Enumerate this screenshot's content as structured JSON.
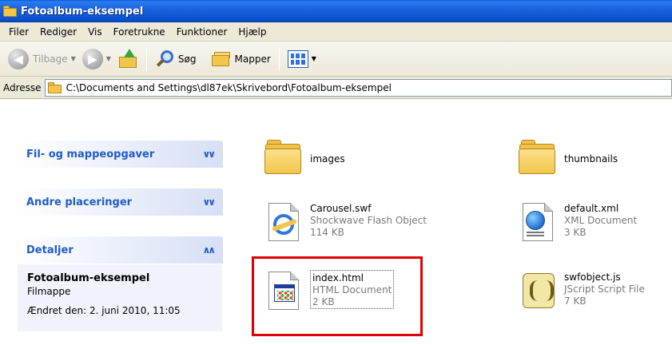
{
  "window": {
    "title": "Fotoalbum-eksempel"
  },
  "menu": [
    "Filer",
    "Rediger",
    "Vis",
    "Foretrukne",
    "Funktioner",
    "Hjælp"
  ],
  "toolbar": {
    "back_label": "Tilbage",
    "search_label": "Søg",
    "folders_label": "Mapper"
  },
  "address": {
    "label": "Adresse",
    "path": "C:\\Documents and Settings\\dl87ek\\Skrivebord\\Fotoalbum-eksempel"
  },
  "tasks": {
    "file_folder_tasks": "Fil- og mappeopgaver",
    "other_places": "Andre placeringer",
    "details": "Detaljer",
    "chevron_collapsed": "»",
    "chevron_expanded": "«"
  },
  "details_panel": {
    "name": "Fotoalbum-eksempel",
    "kind": "Filmappe",
    "modified": "Ændret den: 2. juni 2010, 11:05"
  },
  "files": [
    {
      "name": "images",
      "type": "",
      "size": "",
      "icon": "folder-icon"
    },
    {
      "name": "thumbnails",
      "type": "",
      "size": "",
      "icon": "folder-icon"
    },
    {
      "name": "Carousel.swf",
      "type": "Shockwave Flash Object",
      "size": "114 KB",
      "icon": "internet-explorer-icon"
    },
    {
      "name": "default.xml",
      "type": "XML Document",
      "size": "3 KB",
      "icon": "xml-document-icon"
    },
    {
      "name": "index.html",
      "type": "HTML Document",
      "size": "2 KB",
      "icon": "html-document-icon"
    },
    {
      "name": "swfobject.js",
      "type": "JScript Script File",
      "size": "7 KB",
      "icon": "jscript-file-icon"
    }
  ],
  "colors": {
    "titlebar": "#1a63de",
    "panel_header_text": "#215dc6",
    "highlight_box": "#e00000"
  }
}
